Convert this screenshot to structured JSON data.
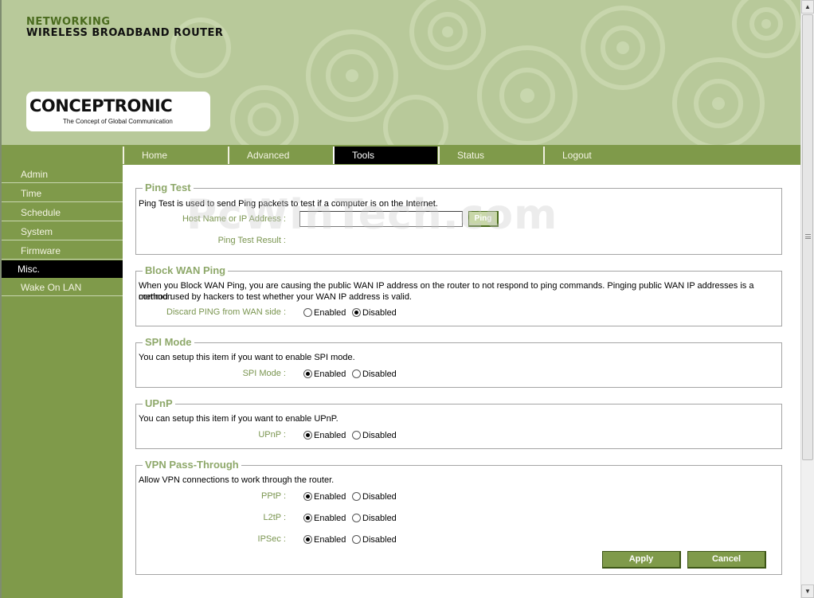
{
  "header": {
    "line1": "NETWORKING",
    "line2": "WIRELESS BROADBAND ROUTER",
    "logo_word": "CONCEPTRONIC",
    "logo_tagline": "The Concept of Global Communication"
  },
  "tabs": [
    {
      "label": "Home",
      "active": false
    },
    {
      "label": "Advanced",
      "active": false
    },
    {
      "label": "Tools",
      "active": true
    },
    {
      "label": "Status",
      "active": false
    },
    {
      "label": "Logout",
      "active": false
    }
  ],
  "sidebar": {
    "items": [
      {
        "label": "Admin"
      },
      {
        "label": "Time"
      },
      {
        "label": "Schedule"
      },
      {
        "label": "System"
      },
      {
        "label": "Firmware"
      },
      {
        "label": "Misc.",
        "active": true
      },
      {
        "label": "Wake On LAN"
      }
    ]
  },
  "watermark": "PcWinTech.com",
  "ping_test": {
    "title": "Ping Test",
    "description": "Ping Test is used to send Ping packets to test if a computer is on the Internet.",
    "host_label": "Host Name or IP Address :",
    "host_value": "",
    "ping_button": "Ping",
    "result_label": "Ping Test Result :",
    "result_value": ""
  },
  "block_wan_ping": {
    "title": "Block WAN Ping",
    "description_line1": "When you Block WAN Ping, you are causing the public WAN IP address on the router to not respond to ping commands. Pinging public WAN IP addresses is a common",
    "description_line2": "method used by hackers to test whether your WAN IP address is valid.",
    "label": "Discard PING from WAN side :",
    "selected": "Disabled"
  },
  "spi_mode": {
    "title": "SPI Mode",
    "description": "You can setup this item if you want to enable SPI mode.",
    "label": "SPI Mode :",
    "selected": "Enabled"
  },
  "upnp": {
    "title": "UPnP",
    "description": "You can setup this item if you want to enable UPnP.",
    "label": "UPnP :",
    "selected": "Enabled"
  },
  "vpn": {
    "title": "VPN Pass-Through",
    "description": "Allow VPN connections to work through the router.",
    "pptp_label": "PPtP :",
    "pptp_selected": "Enabled",
    "l2tp_label": "L2tP :",
    "l2tp_selected": "Enabled",
    "ipsec_label": "IPSec :",
    "ipsec_selected": "Enabled"
  },
  "options": {
    "enabled": "Enabled",
    "disabled": "Disabled"
  },
  "buttons": {
    "apply": "Apply",
    "cancel": "Cancel"
  },
  "colors": {
    "header_bg": "#b8c99a",
    "nav_green": "#7f9a4a",
    "legend_green": "#8ea86a",
    "active_tab": "#000000"
  }
}
